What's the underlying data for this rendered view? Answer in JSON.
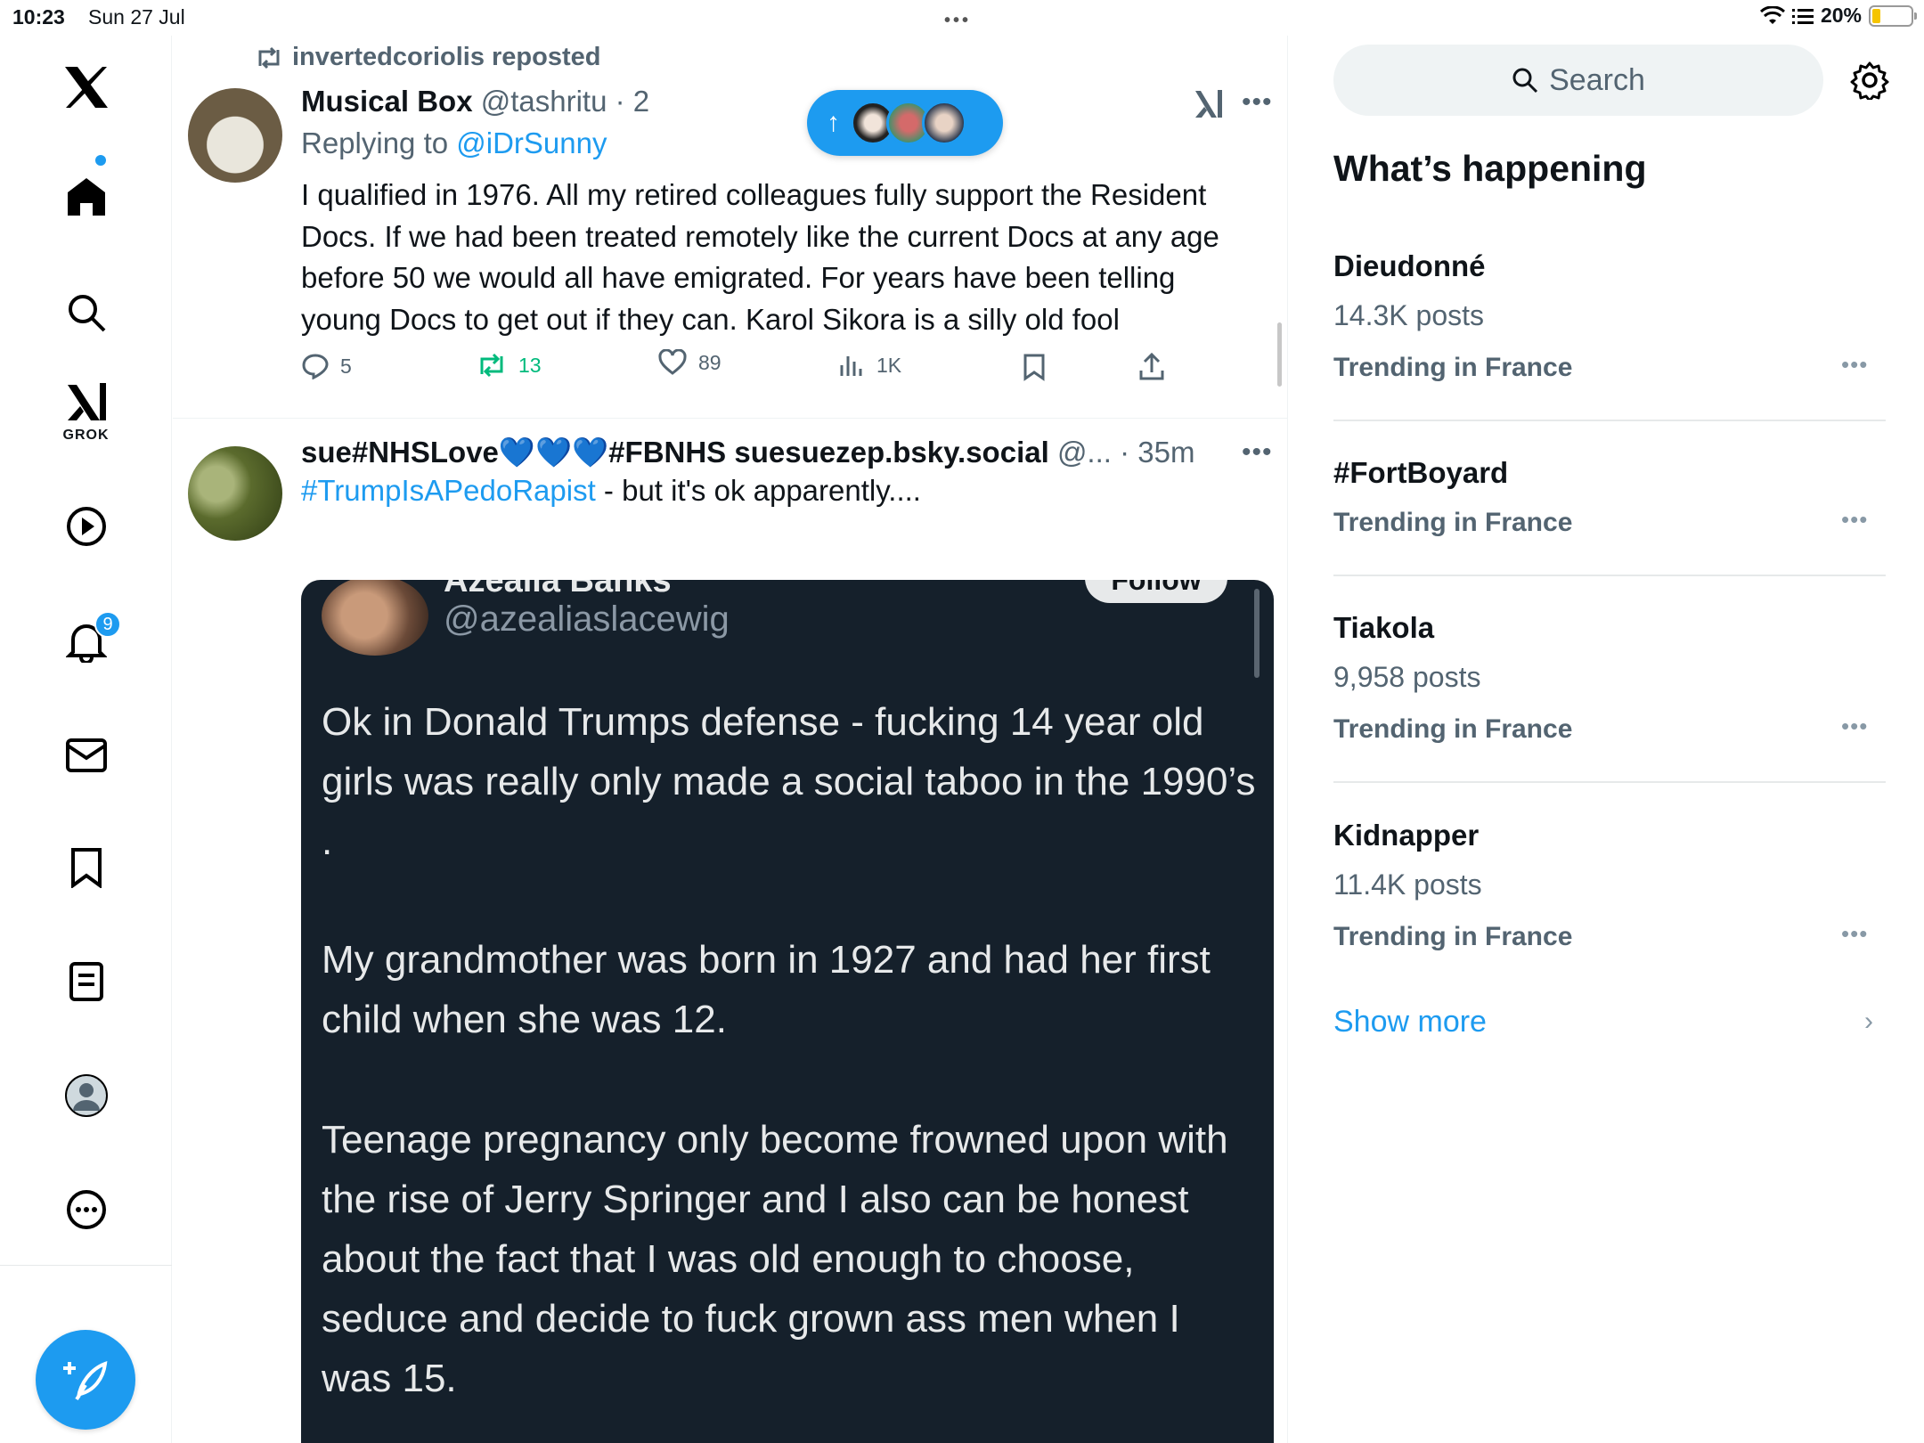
{
  "status_bar": {
    "time": "10:23",
    "date": "Sun 27 Jul",
    "battery": "20%",
    "battery_level": 0.2
  },
  "left_nav": {
    "grok_label": "GROK",
    "notifications_badge": "9",
    "items": [
      "x-logo",
      "home",
      "search",
      "grok",
      "video",
      "notifications",
      "messages",
      "bookmarks",
      "lists",
      "profile",
      "more"
    ]
  },
  "posts": [
    {
      "repost_label": "invertedcoriolis reposted",
      "name": "Musical Box",
      "handle": "@tashritu · 2",
      "replying_prefix": "Replying to ",
      "replying_to": "@iDrSunny",
      "text": "I qualified in 1976. All my retired colleagues fully support the Resident Docs. If we had been treated remotely like the current Docs at any age before 50 we would all have emigrated. For years have been telling young Docs to get out if they can. Karol Sikora is a silly old fool",
      "replies": "5",
      "reposts": "13",
      "likes": "89",
      "views": "1K"
    },
    {
      "name": "sue#NHSLove💙💙💙#FBNHS suesuezep.bsky.social",
      "handle": "@...",
      "time": "· 35m",
      "hashtag": "#TrumpIsAPedoRapist",
      "text": " - but it's ok apparently....",
      "embed": {
        "name": "Azealia Banks",
        "follow": "Follow",
        "handle": "@azealiaslacewig",
        "paragraphs": [
          "Ok in Donald Trumps defense - fucking 14 year old girls was really only made a social taboo in the 1990’s .",
          "My grandmother was born in 1927 and had her first child when she was 12.",
          "Teenage pregnancy only become frowned upon with the rise of Jerry Springer and I also can be honest about the fact that I was old enough to choose, seduce and decide to fuck grown ass men when I was 15."
        ]
      }
    }
  ],
  "right_sidebar": {
    "search_placeholder": "Search",
    "title": "What’s happening",
    "trends": [
      {
        "title": "Dieudonné",
        "count": "14.3K posts",
        "context": "Trending in France"
      },
      {
        "title": "#FortBoyard",
        "count": "",
        "context": "Trending in France"
      },
      {
        "title": "Tiakola",
        "count": "9,958 posts",
        "context": "Trending in France"
      },
      {
        "title": "Kidnapper",
        "count": "11.4K posts",
        "context": "Trending in France"
      }
    ],
    "show_more": "Show more"
  },
  "colors": {
    "accent": "#1d9bf0",
    "repost_green": "#00ba7c",
    "muted": "#536471",
    "embed_bg": "#15202b"
  }
}
